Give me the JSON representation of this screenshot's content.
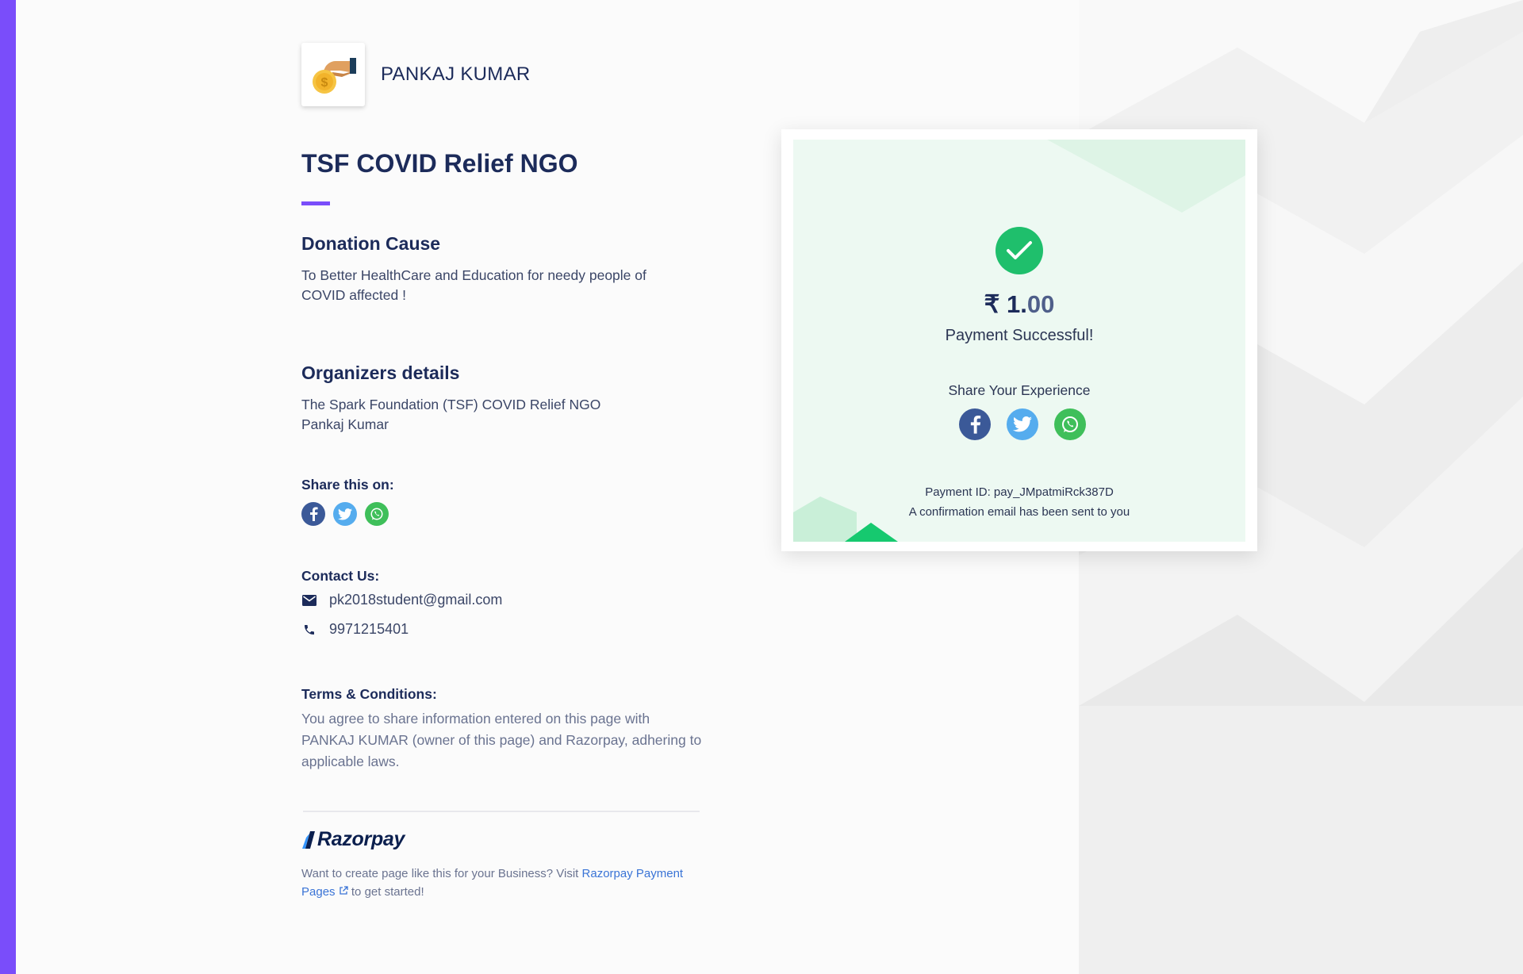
{
  "merchant": {
    "name": "PANKAJ KUMAR",
    "logo_icon": "hand-coin-icon"
  },
  "page": {
    "title": "TSF COVID Relief NGO",
    "accent_color": "#7a4dfa"
  },
  "donation": {
    "heading": "Donation Cause",
    "description": "To Better HealthCare and Education for needy people of COVID affected !"
  },
  "organizers": {
    "heading": "Organizers details",
    "line1": "The Spark Foundation (TSF) COVID Relief NGO",
    "line2": "Pankaj Kumar"
  },
  "share": {
    "heading": "Share this on:",
    "icons": [
      "facebook-icon",
      "twitter-icon",
      "whatsapp-icon"
    ]
  },
  "contact": {
    "heading": "Contact Us:",
    "email": "pk2018student@gmail.com",
    "phone": "9971215401"
  },
  "terms": {
    "heading": "Terms & Conditions:",
    "text": "You agree to share information entered on this page with PANKAJ KUMAR (owner of this page) and Razorpay, adhering to applicable laws."
  },
  "footer": {
    "brand": "Razorpay",
    "text_before": "Want to create page like this for your Business? Visit ",
    "link_text": "Razorpay Payment Pages",
    "text_after": " to get started!"
  },
  "payment": {
    "currency_symbol": "₹",
    "amount_whole": "1.",
    "amount_decimal": "00",
    "status": "Payment Successful!",
    "share_label": "Share Your Experience",
    "payment_id_label": "Payment ID: pay_JMpatmiRck387D",
    "confirmation": "A confirmation email has been sent to you",
    "success_color": "#1fbf6c"
  },
  "colors": {
    "facebook": "#3b5998",
    "twitter": "#55acee",
    "whatsapp": "#3fbf5a"
  }
}
